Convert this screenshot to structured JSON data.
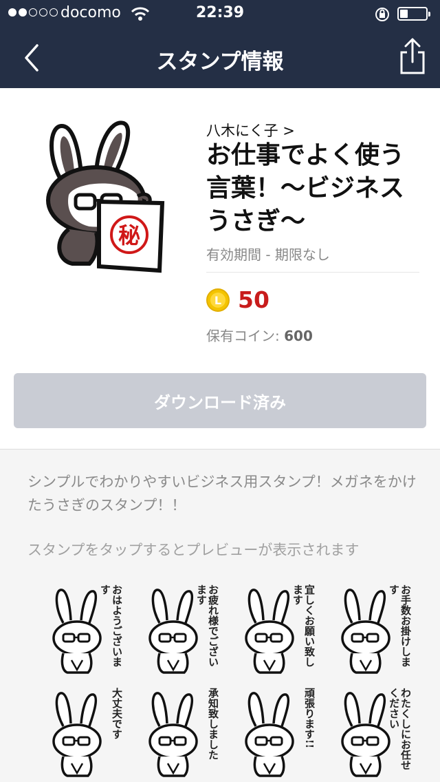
{
  "status": {
    "carrier": "docomo",
    "time": "22:39"
  },
  "nav": {
    "title": "スタンプ情報",
    "back_icon": "chevron-left-icon",
    "share_icon": "share-icon"
  },
  "sticker": {
    "author": "八木にく子 >",
    "title": "お仕事でよく使う言葉！〜ビジネスうさぎ〜",
    "validity": "有効期間 - 期限なし",
    "price": "50",
    "owned_label": "保有コイン: ",
    "owned_value": "600",
    "seal_char": "秘",
    "coin_letter": "L",
    "colors": {
      "price": "#c81c1c",
      "nav": "#242f45",
      "coin": "#f4c400"
    }
  },
  "download_button": "ダウンロード済み",
  "description": "シンプルでわかりやすいビジネス用スタンプ！メガネをかけたうさぎのスタンプ！！",
  "hint": "スタンプをタップするとプレビューが表示されます",
  "stickers": [
    {
      "text": "おはようございます"
    },
    {
      "text": "お疲れ様でございます"
    },
    {
      "text": "宜しくお願い致します"
    },
    {
      "text": "お手数お掛けします"
    },
    {
      "text": "大丈夫です"
    },
    {
      "text": "承知致しました"
    },
    {
      "text": "頑張ります!!"
    },
    {
      "text": "わたくしにお任せください"
    }
  ]
}
